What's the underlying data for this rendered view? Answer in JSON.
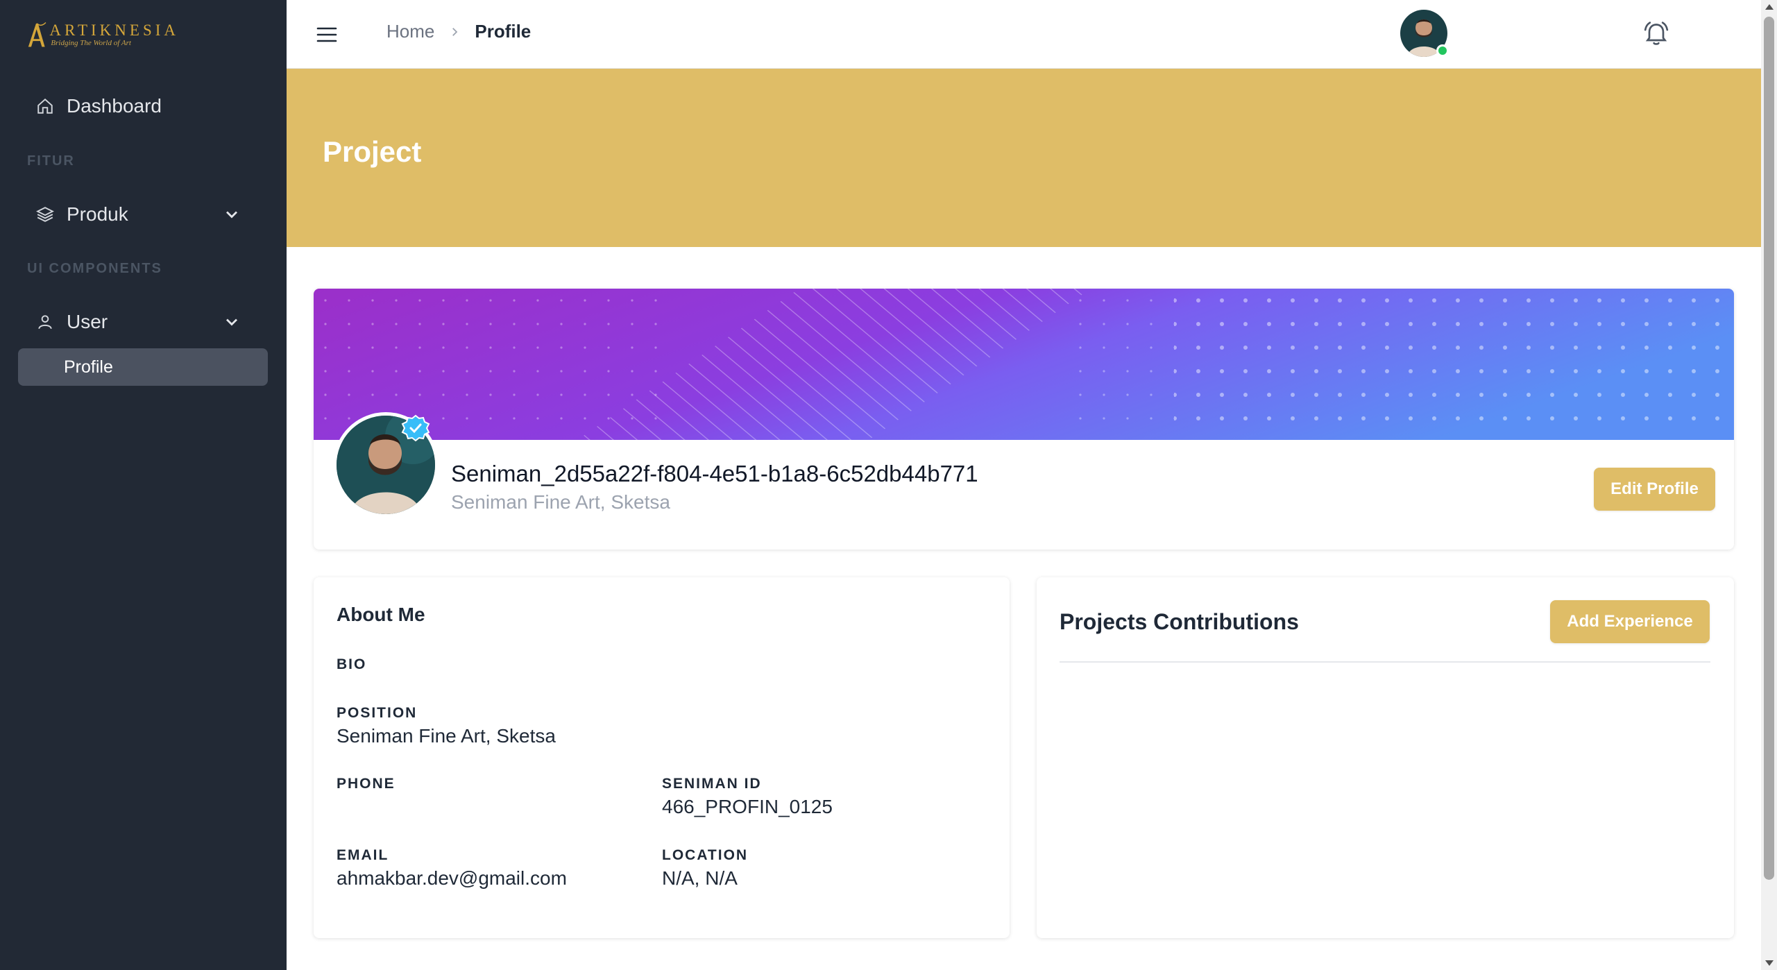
{
  "brand": {
    "name": "ARTIKNESIA",
    "tagline": "Bridging The World of Art",
    "gold": "#d4a63a"
  },
  "sidebar": {
    "dashboard_label": "Dashboard",
    "section_fitur": "FITUR",
    "produk_label": "Produk",
    "section_ui": "UI COMPONENTS",
    "user_label": "User",
    "profile_label": "Profile"
  },
  "topbar": {
    "crumb_home": "Home",
    "crumb_current": "Profile",
    "icons": [
      "menu-icon",
      "chevron-right-icon",
      "bell-icon",
      "avatar"
    ]
  },
  "header": {
    "title": "Project",
    "band_color": "#dfbd67"
  },
  "profile": {
    "name": "Seniman_2d55a22f-f804-4e51-b1a8-6c52db44b771",
    "subtitle": "Seniman Fine Art, Sketsa",
    "edit_button": "Edit Profile"
  },
  "about": {
    "title": "About Me",
    "bio_label": "BIO",
    "bio_value": "",
    "position_label": "POSITION",
    "position_value": "Seniman Fine Art, Sketsa",
    "phone_label": "PHONE",
    "phone_value": "",
    "seniman_id_label": "SENIMAN ID",
    "seniman_id_value": "466_PROFIN_0125",
    "email_label": "EMAIL",
    "email_value": "ahmakbar.dev@gmail.com",
    "location_label": "LOCATION",
    "location_value": "N/A, N/A"
  },
  "projects": {
    "title": "Projects Contributions",
    "add_button": "Add Experience"
  },
  "colors": {
    "sidebar_bg": "#222935",
    "accent": "#dfbd67",
    "online": "#22c55e",
    "verified": "#38bdf8"
  }
}
